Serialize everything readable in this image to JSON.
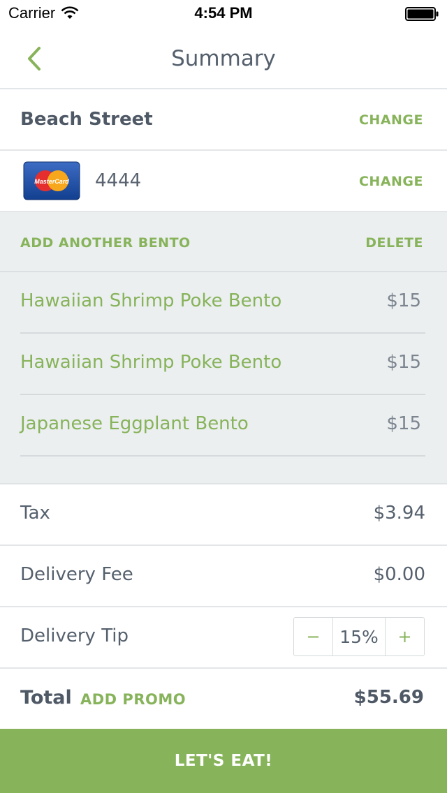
{
  "status_bar": {
    "carrier": "Carrier",
    "time": "4:54 PM"
  },
  "nav": {
    "title": "Summary"
  },
  "address": {
    "label": "Beach Street",
    "change_label": "CHANGE"
  },
  "payment": {
    "card_brand": "MasterCard",
    "card_last4": "4444",
    "change_label": "CHANGE"
  },
  "bento_section": {
    "add_label": "ADD ANOTHER BENTO",
    "delete_label": "DELETE",
    "items": [
      {
        "name": "Hawaiian Shrimp Poke Bento",
        "price": "$15"
      },
      {
        "name": "Hawaiian Shrimp Poke Bento",
        "price": "$15"
      },
      {
        "name": "Japanese Eggplant Bento",
        "price": "$15"
      }
    ]
  },
  "summary": {
    "tax_label": "Tax",
    "tax_value": "$3.94",
    "fee_label": "Delivery Fee",
    "fee_value": "$0.00",
    "tip_label": "Delivery Tip",
    "tip_minus": "−",
    "tip_value": "15%",
    "tip_plus": "+"
  },
  "total": {
    "label": "Total",
    "promo_label": "ADD PROMO",
    "value": "$55.69"
  },
  "cta": {
    "label": "LET'S EAT!"
  },
  "colors": {
    "accent": "#87b35a",
    "text": "#4f5966",
    "section_bg": "#ebeff0"
  }
}
